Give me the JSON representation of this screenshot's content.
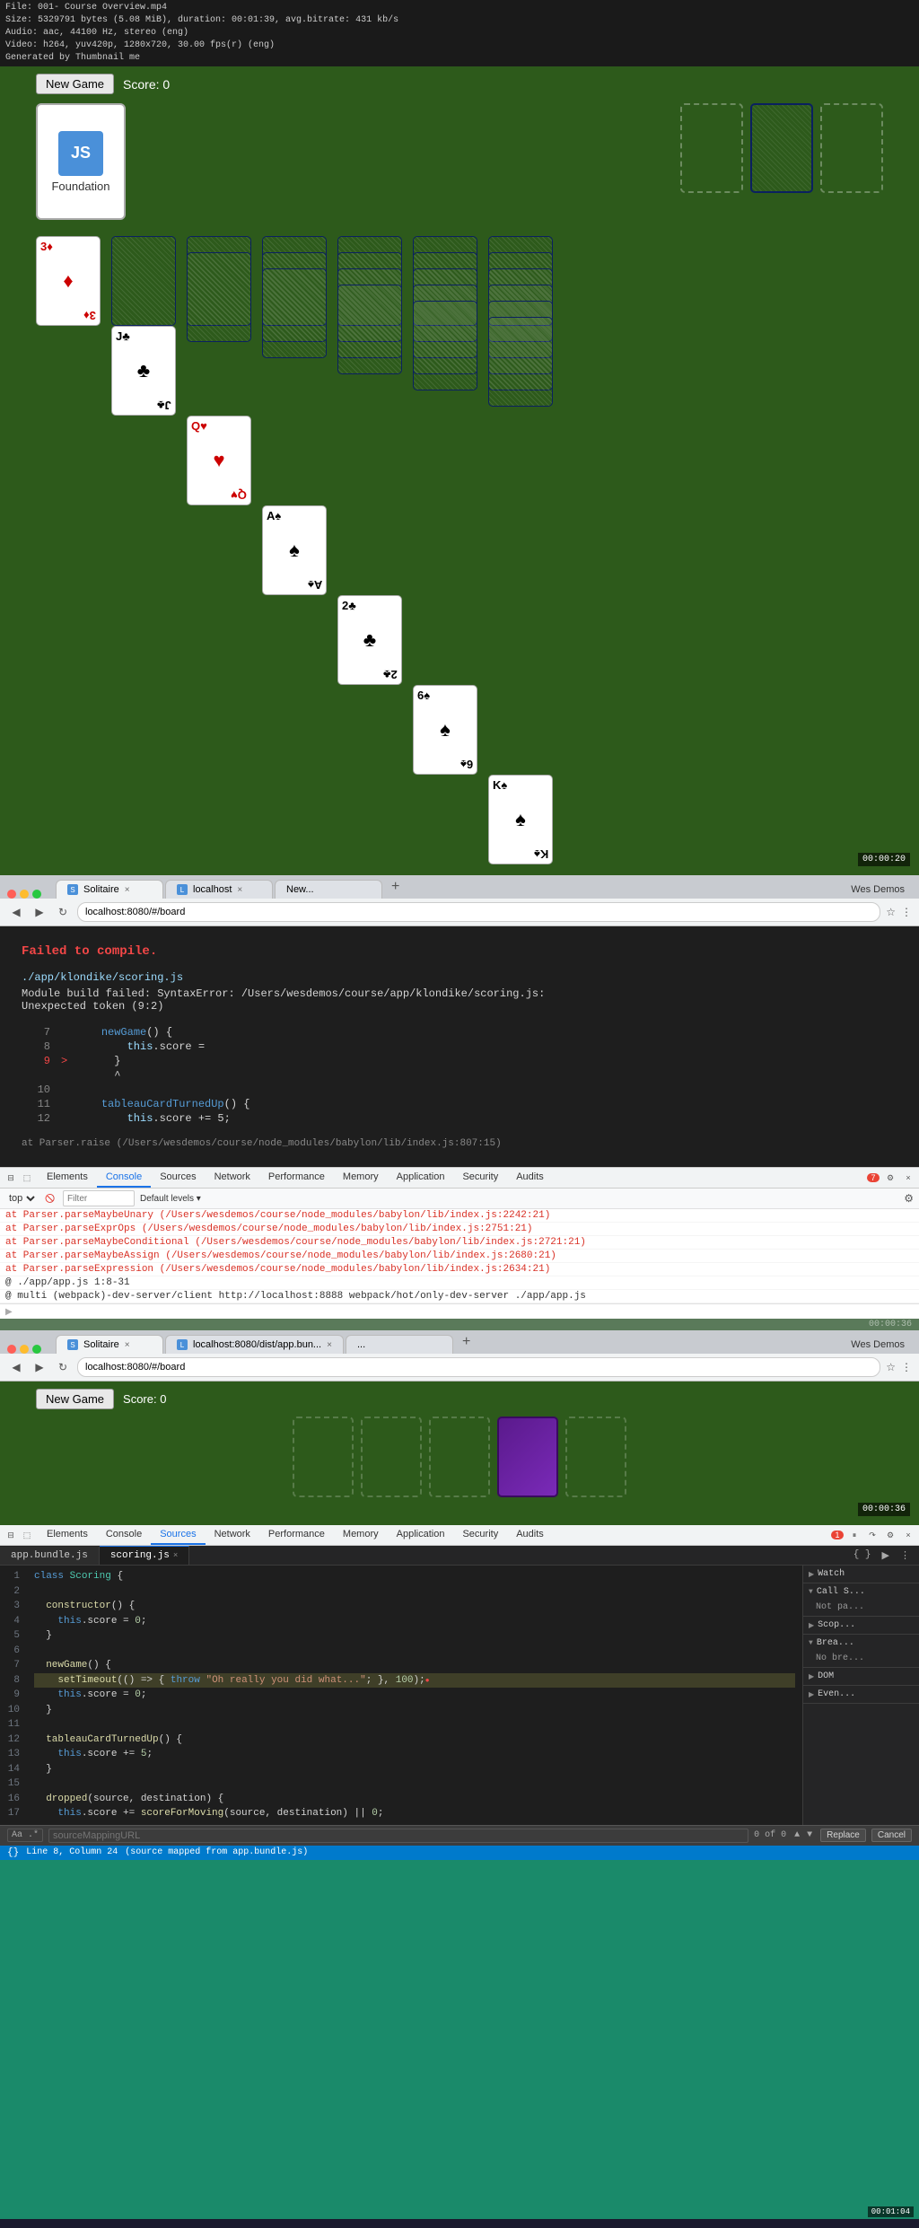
{
  "video_meta": {
    "line1": "File: 001- Course Overview.mp4",
    "line2": "Size: 5329791 bytes (5.08 MiB), duration: 00:01:39, avg.bitrate: 431 kb/s",
    "line3": "Audio: aac, 44100 Hz, stereo (eng)",
    "line4": "Video: h264, yuv420p, 1280x720, 30.00 fps(r) (eng)",
    "line5": "Generated by Thumbnail me"
  },
  "game1": {
    "new_game_label": "New Game",
    "score_label": "Score: 0",
    "js_foundation_label": "Foundation",
    "js_icon_text": "JS"
  },
  "browser1": {
    "tab1_label": "Solitaire",
    "tab2_label": "localhost",
    "tab3_label": "New...",
    "address": "localhost:8080/#/board",
    "profile": "Wes Demos"
  },
  "devtools_error": {
    "title": "Failed to compile.",
    "path": "./app/klondike/scoring.js",
    "desc": "Module build failed: SyntaxError: /Users/wesdemos/course/app/klondike/scoring.js:",
    "desc2": "Unexpected token (9:2)",
    "lines": [
      {
        "num": "7",
        "arrow": "",
        "text": "  newGame() {"
      },
      {
        "num": "8",
        "arrow": "",
        "text": "    this.score ="
      },
      {
        "num": "9",
        "arrow": ">",
        "text": "  }"
      },
      {
        "num": "",
        "arrow": "",
        "text": "  ^"
      },
      {
        "num": "10",
        "arrow": "",
        "text": ""
      },
      {
        "num": "11",
        "arrow": "",
        "text": "  tableauCardTurnedUp() {"
      },
      {
        "num": "12",
        "arrow": "",
        "text": "    this.score += 5;"
      }
    ],
    "stack_line": "at Parser.raise (/Users/wesdemos/course/node_modules/babylon/lib/index.js:807:15)"
  },
  "devtools1": {
    "tabs": [
      "Elements",
      "Console",
      "Sources",
      "Network",
      "Performance",
      "Memory",
      "Application",
      "Security",
      "Audits"
    ],
    "active_tab": "Console",
    "badge": "7",
    "filter_placeholder": "Filter",
    "default_levels": "Default levels ▾",
    "context_selector": "top"
  },
  "console_messages": [
    {
      "text": "at Parser.parseMaybeUnary (/Users/wesdemos/course/node_modules/babylon/lib/index.js:2242:21)",
      "loc": ""
    },
    {
      "text": "at Parser.parseExprOps (/Users/wesdemos/course/node_modules/babylon/lib/index.js:2751:21)",
      "loc": ""
    },
    {
      "text": "at Parser.parseMaybeConditional (/Users/wesdemos/course/node_modules/babylon/lib/index.js:2721:21)",
      "loc": ""
    },
    {
      "text": "at Parser.parseMaybeAssign (/Users/wesdemos/course/node_modules/babylon/lib/index.js:2680:21)",
      "loc": ""
    },
    {
      "text": "at Parser.parseExpression (/Users/wesdemos/course/node_modules/babylon/lib/index.js:2634:21)",
      "loc": ""
    },
    {
      "text": "@ ./app/app.js 1:8-31",
      "loc": "",
      "type": "info"
    },
    {
      "text": "@ multi (webpack)-dev-server/client http://localhost:8888 webpack/hot/only-dev-server ./app/app.js",
      "loc": "",
      "type": "info"
    }
  ],
  "game2": {
    "new_game_label": "New Game",
    "score_label": "Score: 0"
  },
  "browser2": {
    "tab1_label": "Solitaire",
    "tab2_label": "localhost:8080/dist/app.bun...",
    "tab3_label": "...",
    "address": "localhost:8080/#/board",
    "profile": "Wes Demos"
  },
  "devtools2": {
    "tabs": [
      "Elements",
      "Console",
      "Sources",
      "Network",
      "Performance",
      "Memory",
      "Application",
      "Security",
      "Audits"
    ],
    "active_tab": "Sources",
    "badge": "1"
  },
  "sources_tabs": [
    {
      "label": "app.bundle.js",
      "active": false
    },
    {
      "label": "scoring.js",
      "active": true
    }
  ],
  "source_code": {
    "lines": [
      {
        "num": 1,
        "text": "class Scoring {",
        "highlight": false
      },
      {
        "num": 2,
        "text": "",
        "highlight": false
      },
      {
        "num": 3,
        "text": "  constructor() {",
        "highlight": false
      },
      {
        "num": 4,
        "text": "    this.score = 0;",
        "highlight": false
      },
      {
        "num": 5,
        "text": "  }",
        "highlight": false
      },
      {
        "num": 6,
        "text": "",
        "highlight": false
      },
      {
        "num": 7,
        "text": "  newGame() {",
        "highlight": false
      },
      {
        "num": 8,
        "text": "    setTimeout(() => { throw \"Oh really you did what...\"; }, 100);",
        "highlight": true,
        "has_error_dot": true
      },
      {
        "num": 9,
        "text": "    this.score = 0;",
        "highlight": false
      },
      {
        "num": 10,
        "text": "  }",
        "highlight": false
      },
      {
        "num": 11,
        "text": "",
        "highlight": false
      },
      {
        "num": 12,
        "text": "  tableauCardTurnedUp() {",
        "highlight": false
      },
      {
        "num": 13,
        "text": "    this.score += 5;",
        "highlight": false
      },
      {
        "num": 14,
        "text": "  }",
        "highlight": false
      },
      {
        "num": 15,
        "text": "",
        "highlight": false
      },
      {
        "num": 16,
        "text": "  dropped(source, destination) {",
        "highlight": false
      },
      {
        "num": 17,
        "text": "    this.score += scoreForMoving(source, destination) || 0;",
        "highlight": false
      }
    ]
  },
  "right_panel": {
    "sections": [
      {
        "label": "Watch",
        "open": true,
        "content": ""
      },
      {
        "label": "Call S...",
        "open": true,
        "content": "Not pa..."
      },
      {
        "label": "Scop...",
        "open": true,
        "content": ""
      },
      {
        "label": "Brea...",
        "open": true,
        "content": "No bre..."
      },
      {
        "label": "DOM",
        "open": true,
        "content": ""
      },
      {
        "label": "Even...",
        "open": true,
        "content": ""
      }
    ]
  },
  "search_bar": {
    "options_label": "Aa .*",
    "placeholder": "sourceMappingURL",
    "count": "0 of 0",
    "replace_label": "Replace",
    "cancel_label": "Cancel"
  },
  "status_bar": {
    "text": "Line 8, Column 24",
    "source_mapped": "(source mapped from app.bundle.js)",
    "curly_label": "{}"
  },
  "timers": {
    "timer1": "00:00:20",
    "timer2": "00:00:36",
    "timer3": "00:01:04"
  },
  "section_dividers": {
    "div1": "00:00:20",
    "div2": "00:00:36",
    "div3": "00:01:04"
  }
}
